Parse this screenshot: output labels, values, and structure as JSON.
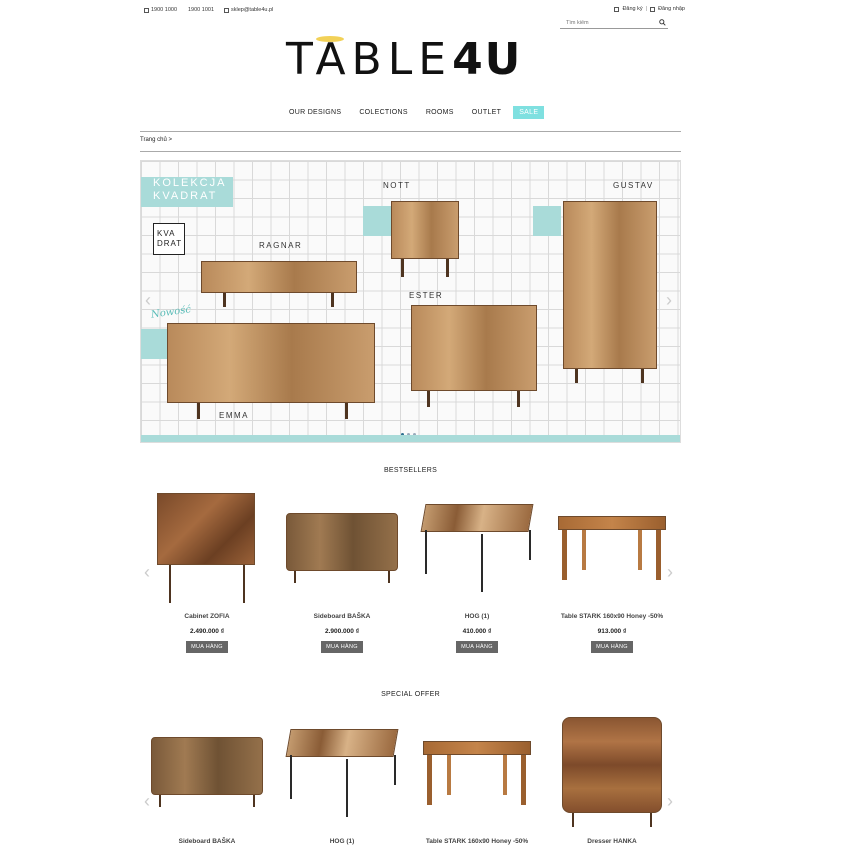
{
  "topbar": {
    "phone1": "1900 1000",
    "phone2": "1900 1001",
    "email": "sklep@table4u.pl",
    "register": "Đăng ký",
    "login": "Đăng nhập"
  },
  "search": {
    "placeholder": "Tìm kiếm"
  },
  "logo": {
    "text": "TABLE",
    "number": "4U"
  },
  "nav": {
    "items": [
      "OUR DESIGNS",
      "COLECTIONS",
      "ROOMS",
      "OUTLET"
    ],
    "sale": "SALE"
  },
  "breadcrumb": {
    "home": "Trang chủ",
    "sep": ">"
  },
  "banner": {
    "collection_line1": "KOLEKCJA",
    "collection_line2": "KVADRAT",
    "badge_line1": "KVA",
    "badge_line2": "DRAT",
    "new_label": "Nowość",
    "labels": [
      "RAGNAR",
      "NOTT",
      "GUSTAV",
      "ESTER",
      "EMMA"
    ]
  },
  "bestsellers": {
    "title": "BESTSELLERS",
    "buy_label": "MUA HÀNG",
    "products": [
      {
        "name": "Cabinet ZOFIA",
        "price": "2.490.000 ₫"
      },
      {
        "name": "Sideboard BAŠKA",
        "price": "2.900.000 ₫"
      },
      {
        "name": "HOG (1)",
        "price": "410.000 ₫"
      },
      {
        "name": "Table STARK 160x90 Honey -50%",
        "price": "913.000 ₫"
      }
    ]
  },
  "special": {
    "title": "SPECIAL OFFER",
    "products": [
      {
        "name": "Sideboard BAŠKA"
      },
      {
        "name": "HOG (1)"
      },
      {
        "name": "Table STARK 160x90 Honey -50%"
      },
      {
        "name": "Dresser HANKA"
      }
    ]
  },
  "colors": {
    "accent": "#7fe0e0",
    "teal": "#a9dbd9",
    "wood": "#b98a5b",
    "button": "#666666"
  }
}
